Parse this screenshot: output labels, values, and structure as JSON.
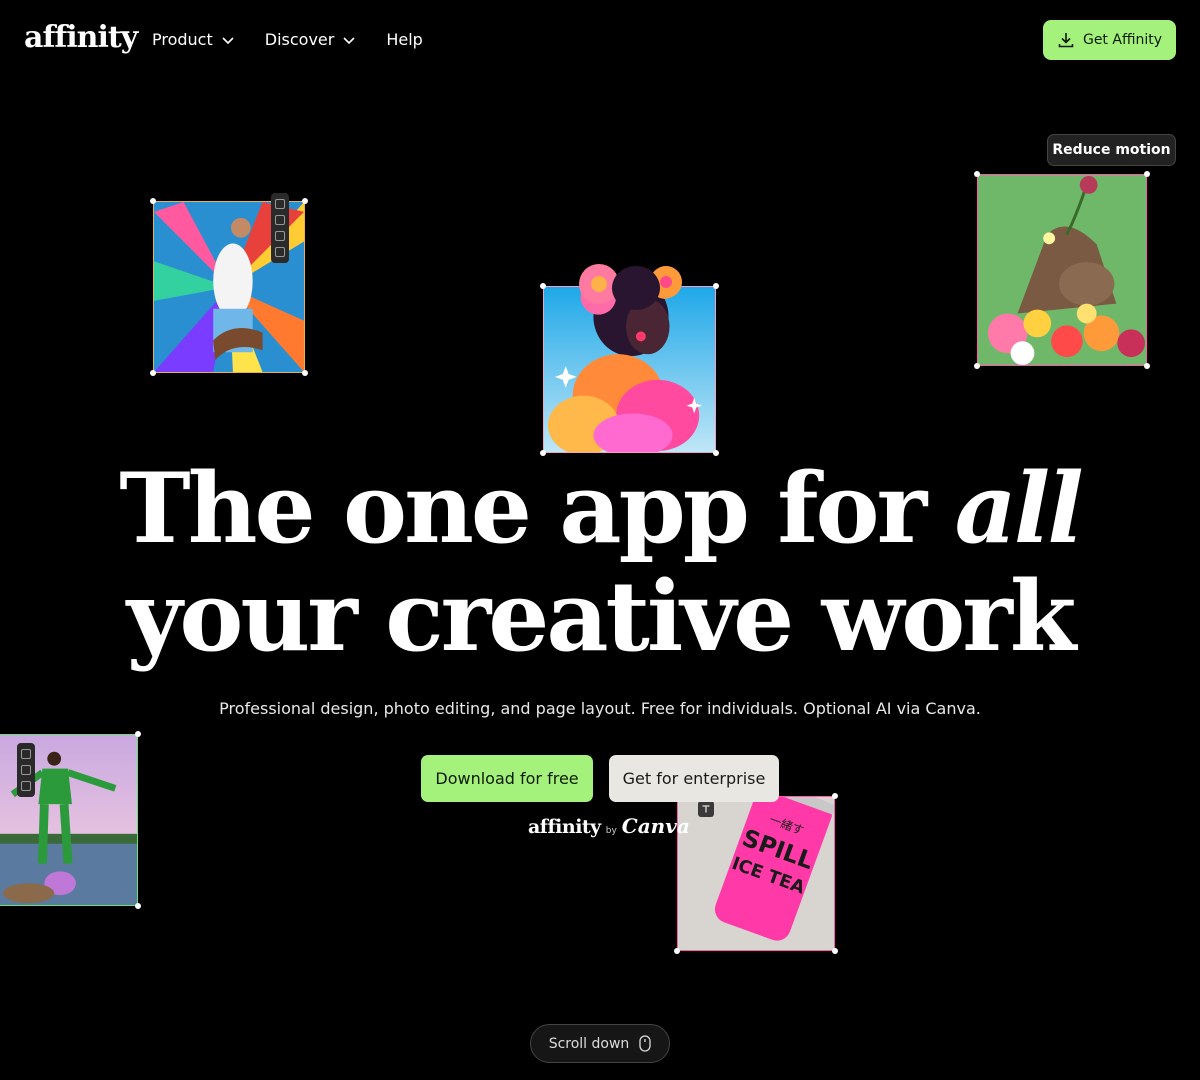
{
  "header": {
    "logo": "affinity",
    "nav": [
      {
        "label": "Product"
      },
      {
        "label": "Discover"
      },
      {
        "label": "Help"
      }
    ],
    "cta_label": "Get Affinity"
  },
  "reduce_motion_label": "Reduce motion",
  "hero": {
    "line1_a": "The one app for",
    "line1_b": "all",
    "line2": "your creative work",
    "subtitle": "Professional design, photo editing, and page layout. Free for individuals. Optional AI via Canva.",
    "primary_label": "Download for free",
    "secondary_label": "Get for enterprise",
    "brand_affinity": "affinity",
    "brand_by": "by",
    "brand_canva": "Canva"
  },
  "can_text": {
    "top": "一緒す",
    "main1": "SPILL",
    "main2": "ICE TEA"
  },
  "scroll_label": "Scroll down",
  "colors": {
    "accent_green": "#a4f27b",
    "enterprise_bg": "#e9e7e2",
    "background": "#000000"
  }
}
